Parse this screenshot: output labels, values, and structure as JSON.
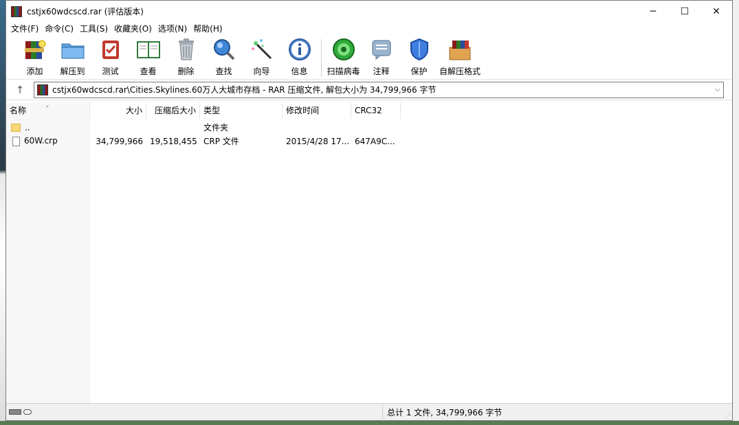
{
  "window": {
    "title": "cstjx60wdcscd.rar (评估版本)",
    "controls": {
      "minimize": "─",
      "maximize": "☐",
      "close": "✕"
    }
  },
  "menu": [
    "文件(F)",
    "命令(C)",
    "工具(S)",
    "收藏夹(O)",
    "选项(N)",
    "帮助(H)"
  ],
  "toolbar": [
    {
      "label": "添加",
      "icon": "add-archive-icon"
    },
    {
      "label": "解压到",
      "icon": "extract-folder-icon"
    },
    {
      "label": "测试",
      "icon": "test-clipboard-icon"
    },
    {
      "label": "查看",
      "icon": "view-book-icon"
    },
    {
      "label": "删除",
      "icon": "trash-icon"
    },
    {
      "label": "查找",
      "icon": "find-magnifier-icon"
    },
    {
      "label": "向导",
      "icon": "wizard-wand-icon"
    },
    {
      "label": "信息",
      "icon": "info-icon"
    },
    {
      "label": "扫描病毒",
      "icon": "virus-scan-icon"
    },
    {
      "label": "注释",
      "icon": "comment-icon"
    },
    {
      "label": "保护",
      "icon": "shield-icon"
    },
    {
      "label": "自解压格式",
      "icon": "sfx-box-icon"
    }
  ],
  "address": {
    "up": "↑",
    "path": "cstjx60wdcscd.rar\\Cities.Skylines.60万人大城市存档 - RAR 压缩文件, 解包大小为 34,799,966 字节",
    "dropdown": "⌵"
  },
  "columns": [
    "名称",
    "大小",
    "压缩后大小",
    "类型",
    "修改时间",
    "CRC32"
  ],
  "rows": [
    {
      "name": "..",
      "size": "",
      "packed": "",
      "type": "文件夹",
      "modified": "",
      "crc": "",
      "kind": "folder"
    },
    {
      "name": "60W.crp",
      "size": "34,799,966",
      "packed": "19,518,455",
      "type": "CRP 文件",
      "modified": "2015/4/28 17...",
      "crc": "647A9C...",
      "kind": "file"
    }
  ],
  "status": {
    "summary": "总计 1 文件, 34,799,966 字节"
  },
  "colors": {
    "folder": "#f8d775",
    "window_bg": "#ffffff",
    "statusbar": "#f0f0f0"
  }
}
